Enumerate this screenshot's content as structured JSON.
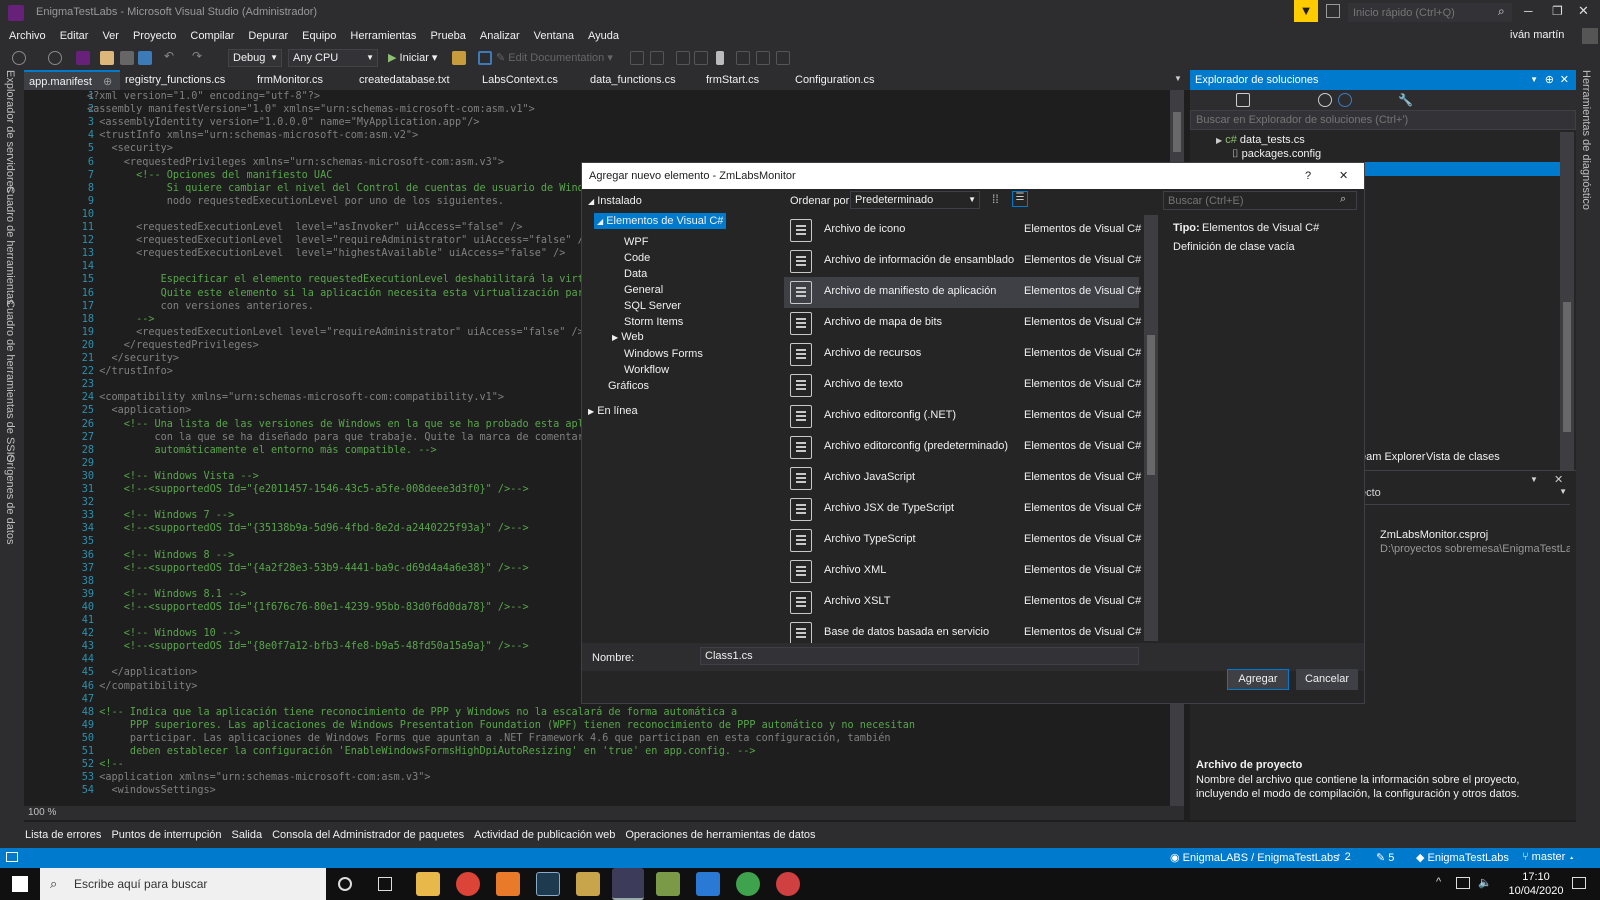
{
  "titlebar": {
    "title": "EnigmaTestLabs - Microsoft Visual Studio  (Administrador)",
    "quick_launch_placeholder": "Inicio rápido (Ctrl+Q)",
    "user": "iván martín"
  },
  "menu": [
    "Archivo",
    "Editar",
    "Ver",
    "Proyecto",
    "Compilar",
    "Depurar",
    "Equipo",
    "Herramientas",
    "Prueba",
    "Analizar",
    "Ventana",
    "Ayuda"
  ],
  "toolbar": {
    "config": "Debug",
    "platform": "Any CPU",
    "start_label": "Iniciar",
    "edit_documentation": "Edit Documentation"
  },
  "left_tabs": [
    "Explorador de servidores",
    "Cuadro de herramientas",
    "Cuadro de herramientas de SSIS",
    "Orígenes de datos"
  ],
  "right_tabs": [
    "Herramientas de diagnóstico"
  ],
  "doc_tabs": [
    "app.manifest",
    "registry_functions.cs",
    "frmMonitor.cs",
    "createdatabase.txt",
    "LabsContext.cs",
    "data_functions.cs",
    "frmStart.cs",
    "Configuration.cs"
  ],
  "editor": {
    "zoom": "100 %",
    "line_numbers": [
      "1",
      "2",
      "3",
      "4",
      "5",
      "6",
      "7",
      "8",
      "9",
      "10",
      "11",
      "12",
      "13",
      "14",
      "15",
      "16",
      "17",
      "18",
      "19",
      "20",
      "21",
      "22",
      "23",
      "24",
      "25",
      "26",
      "27",
      "28",
      "29",
      "30",
      "31",
      "32",
      "33",
      "34",
      "35",
      "36",
      "37",
      "38",
      "39",
      "40",
      "41",
      "42",
      "43",
      "44",
      "45",
      "46",
      "47",
      "48",
      "49",
      "50",
      "51",
      "52",
      "53",
      "54"
    ],
    "lines": [
      "<?xml version=\"1.0\" encoding=\"utf-8\"?>",
      "<assembly manifestVersion=\"1.0\" xmlns=\"urn:schemas-microsoft-com:asm.v1\">",
      "  <assemblyIdentity version=\"1.0.0.0\" name=\"MyApplication.app\"/>",
      "  <trustInfo xmlns=\"urn:schemas-microsoft-com:asm.v2\">",
      "    <security>",
      "      <requestedPrivileges xmlns=\"urn:schemas-microsoft-com:asm.v3\">",
      "        <!-- Opciones del manifiesto UAC",
      "             Si quiere cambiar el nivel del Control de cuentas de usuario de Windows",
      "             nodo requestedExecutionLevel por uno de los siguientes.",
      "",
      "        <requestedExecutionLevel  level=\"asInvoker\" uiAccess=\"false\" />",
      "        <requestedExecutionLevel  level=\"requireAdministrator\" uiAccess=\"false\" />",
      "        <requestedExecutionLevel  level=\"highestAvailable\" uiAccess=\"false\" />",
      "",
      "            Especificar el elemento requestedExecutionLevel deshabilitará la virtuali",
      "            Quite este elemento si la aplicación necesita esta virtualización para la",
      "            con versiones anteriores.",
      "        -->",
      "        <requestedExecutionLevel level=\"requireAdministrator\" uiAccess=\"false\" />",
      "      </requestedPrivileges>",
      "    </security>",
      "  </trustInfo>",
      "",
      "  <compatibility xmlns=\"urn:schemas-microsoft-com:compatibility.v1\">",
      "    <application>",
      "      <!-- Una lista de las versiones de Windows en la que se ha probado esta aplicac",
      "           con la que se ha diseñado para que trabaje. Quite la marca de comentario c",
      "           automáticamente el entorno más compatible. -->",
      "",
      "      <!-- Windows Vista -->",
      "      <!--<supportedOS Id=\"{e2011457-1546-43c5-a5fe-008deee3d3f0}\" />-->",
      "",
      "      <!-- Windows 7 -->",
      "      <!--<supportedOS Id=\"{35138b9a-5d96-4fbd-8e2d-a2440225f93a}\" />-->",
      "",
      "      <!-- Windows 8 -->",
      "      <!--<supportedOS Id=\"{4a2f28e3-53b9-4441-ba9c-d69d4a4a6e38}\" />-->",
      "",
      "      <!-- Windows 8.1 -->",
      "      <!--<supportedOS Id=\"{1f676c76-80e1-4239-95bb-83d0f6d0da78}\" />-->",
      "",
      "      <!-- Windows 10 -->",
      "      <!--<supportedOS Id=\"{8e0f7a12-bfb3-4fe8-b9a5-48fd50a15a9a}\" />-->",
      "",
      "    </application>",
      "  </compatibility>",
      "",
      "  <!-- Indica que la aplicación tiene reconocimiento de PPP y Windows no la escalará de forma automática a",
      "       PPP superiores. Las aplicaciones de Windows Presentation Foundation (WPF) tienen reconocimiento de PPP automático y no necesitan",
      "       participar. Las aplicaciones de Windows Forms que apuntan a .NET Framework 4.6 que participan en esta configuración, también",
      "       deben establecer la configuración 'EnableWindowsFormsHighDpiAutoResizing' en 'true' en app.config. -->",
      "  <!--",
      "  <application xmlns=\"urn:schemas-microsoft-com:asm.v3\">",
      "    <windowsSettings>"
    ]
  },
  "solution_explorer": {
    "title": "Explorador de soluciones",
    "search_placeholder": "Buscar en Explorador de soluciones (Ctrl+')",
    "tree": [
      "data_tests.cs",
      "packages.config"
    ],
    "lower_tabs": [
      "eam Explorer",
      "Vista de clases"
    ],
    "props_selector": "ecto",
    "project_file": "ZmLabsMonitor.csproj",
    "project_path": "D:\\proyectos sobremesa\\EnigmaTestLabs\\Z",
    "desc_title": "Archivo de proyecto",
    "desc_text": "Nombre del archivo que contiene la información sobre el proyecto, incluyendo el modo de compilación, la configuración y otros datos."
  },
  "dialog": {
    "title": "Agregar nuevo elemento - ZmLabsMonitor",
    "help": "?",
    "close": "✕",
    "installed": "Instalado",
    "tree": [
      "Elementos de Visual C#",
      "WPF",
      "Code",
      "Data",
      "General",
      "SQL Server",
      "Storm Items",
      "Web",
      "Windows Forms",
      "Workflow",
      "Gráficos"
    ],
    "online": "En línea",
    "sort_label": "Ordenar por:",
    "sort_value": "Predeterminado",
    "search_placeholder": "Buscar (Ctrl+E)",
    "items": [
      {
        "name": "Archivo de icono",
        "cat": "Elementos de Visual C#"
      },
      {
        "name": "Archivo de información de ensamblado",
        "cat": "Elementos de Visual C#"
      },
      {
        "name": "Archivo de manifiesto de aplicación",
        "cat": "Elementos de Visual C#"
      },
      {
        "name": "Archivo de mapa de bits",
        "cat": "Elementos de Visual C#"
      },
      {
        "name": "Archivo de recursos",
        "cat": "Elementos de Visual C#"
      },
      {
        "name": "Archivo de texto",
        "cat": "Elementos de Visual C#"
      },
      {
        "name": "Archivo editorconfig (.NET)",
        "cat": "Elementos de Visual C#"
      },
      {
        "name": "Archivo editorconfig (predeterminado)",
        "cat": "Elementos de Visual C#"
      },
      {
        "name": "Archivo JavaScript",
        "cat": "Elementos de Visual C#"
      },
      {
        "name": "Archivo JSX de TypeScript",
        "cat": "Elementos de Visual C#"
      },
      {
        "name": "Archivo TypeScript",
        "cat": "Elementos de Visual C#"
      },
      {
        "name": "Archivo XML",
        "cat": "Elementos de Visual C#"
      },
      {
        "name": "Archivo XSLT",
        "cat": "Elementos de Visual C#"
      },
      {
        "name": "Base de datos basada en servicio",
        "cat": "Elementos de Visual C#"
      }
    ],
    "type_label": "Tipo:",
    "type_value": "Elementos de Visual C#",
    "description": "Definición de clase vacía",
    "name_label": "Nombre:",
    "name_value": "Class1.cs",
    "add_button": "Agregar",
    "cancel_button": "Cancelar"
  },
  "bottom_tabs": [
    "Lista de errores",
    "Puntos de interrupción",
    "Salida",
    "Consola del Administrador de paquetes",
    "Actividad de publicación web",
    "Operaciones de herramientas de datos"
  ],
  "status": {
    "repo": "EnigmaLABS / EnigmaTestLabs",
    "push": "2",
    "changes": "5",
    "project": "EnigmaTestLabs",
    "branch": "master"
  },
  "taskbar": {
    "search_placeholder": "Escribe aquí para buscar",
    "time": "17:10",
    "date": "10/04/2020"
  }
}
